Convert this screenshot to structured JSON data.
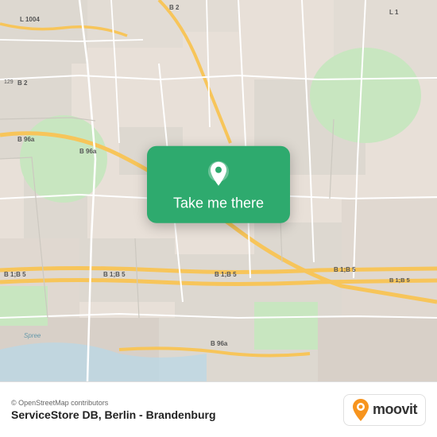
{
  "map": {
    "attribution": "© OpenStreetMap contributors",
    "background_color": "#e8e0d8"
  },
  "popup": {
    "button_label": "Take me there",
    "pin_icon": "location-pin-icon"
  },
  "bottom_bar": {
    "location_label": "ServiceStore DB, Berlin - Brandenburg",
    "moovit_text": "moovit",
    "moovit_logo_alt": "Moovit Logo"
  }
}
